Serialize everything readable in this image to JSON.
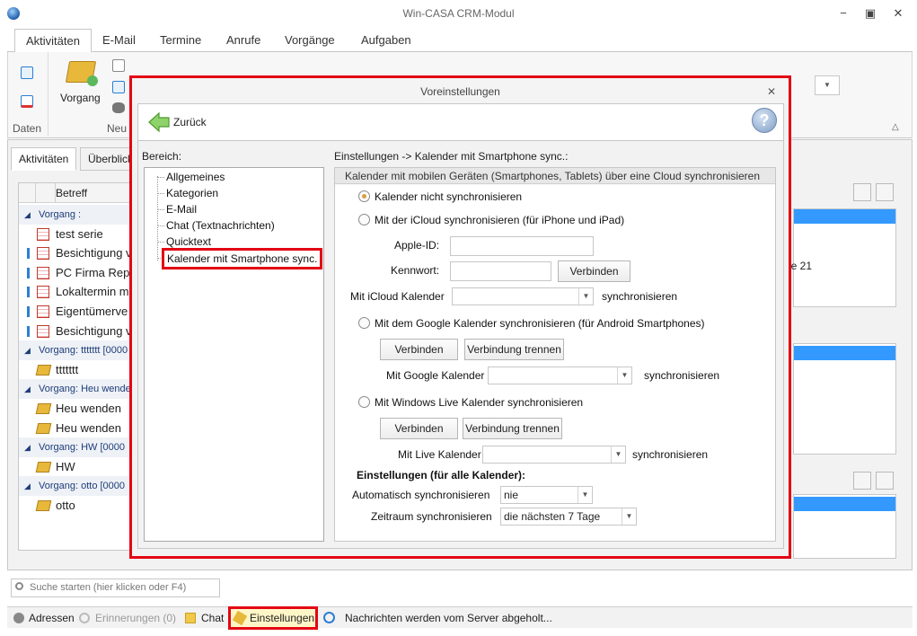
{
  "window": {
    "title": "Win-CASA CRM-Modul",
    "minimize": "−",
    "restore": "▣",
    "close": "✕"
  },
  "ribbon_tabs": [
    "Aktivitäten",
    "E-Mail",
    "Termine",
    "Anrufe",
    "Vorgänge",
    "Aufgaben"
  ],
  "ribbon": {
    "group_daten": "Daten",
    "vorgang_label": "Vorgang",
    "group_neu": "Neu",
    "collapse": "△"
  },
  "subtabs": [
    "Aktivitäten",
    "Überblick"
  ],
  "list": {
    "column_header": "Betreff",
    "rows": [
      {
        "type": "group",
        "text": "Vorgang :"
      },
      {
        "type": "item",
        "icon": "calendar-icon",
        "text": "test serie",
        "marked": false
      },
      {
        "type": "item",
        "icon": "calendar-icon",
        "text": "Besichtigung v",
        "marked": true
      },
      {
        "type": "item",
        "icon": "calendar-icon",
        "text": "PC Firma Rep",
        "marked": true
      },
      {
        "type": "item",
        "icon": "calendar-icon",
        "text": "Lokaltermin m",
        "marked": true
      },
      {
        "type": "item",
        "icon": "calendar-icon",
        "text": "Eigentümerve",
        "marked": true
      },
      {
        "type": "item",
        "icon": "calendar-icon",
        "text": "Besichtigung v",
        "marked": true
      },
      {
        "type": "group",
        "text": "Vorgang: ttttttt [0000"
      },
      {
        "type": "item",
        "icon": "vorgang-icon",
        "text": "ttttttt",
        "marked": false
      },
      {
        "type": "group",
        "text": "Vorgang: Heu wende"
      },
      {
        "type": "item",
        "icon": "vorgang-icon",
        "text": "Heu wenden",
        "marked": false
      },
      {
        "type": "item",
        "icon": "vorgang-icon",
        "text": "Heu wenden",
        "marked": false
      },
      {
        "type": "group",
        "text": "Vorgang: HW [0000"
      },
      {
        "type": "item",
        "icon": "vorgang-icon",
        "text": "HW",
        "marked": false
      },
      {
        "type": "group",
        "text": "Vorgang: otto [0000"
      },
      {
        "type": "item",
        "icon": "vorgang-icon",
        "text": "otto",
        "marked": false
      }
    ]
  },
  "right_panel": {
    "text": "ee 21"
  },
  "search": {
    "placeholder": "Suche starten (hier klicken oder F4)"
  },
  "statusbar": {
    "adressen": "Adressen",
    "erinnerungen": "Erinnerungen (0)",
    "chat": "Chat",
    "einstellungen": "Einstellungen",
    "message": "Nachrichten werden vom Server abgeholt..."
  },
  "dialog": {
    "title": "Voreinstellungen",
    "close": "✕",
    "back_label": "Zurück",
    "help": "?",
    "bereich_label": "Bereich:",
    "tree_items": [
      "Allgemeines",
      "Kategorien",
      "E-Mail",
      "Chat (Textnachrichten)",
      "Quicktext",
      "Kalender mit Smartphone sync."
    ],
    "breadcrumb": "Einstellungen -> Kalender mit Smartphone sync.:",
    "section_header": "Kalender mit mobilen Geräten (Smartphones, Tablets) über eine Cloud synchronisieren",
    "options": {
      "no_sync": "Kalender nicht synchronisieren",
      "icloud": "Mit der iCloud synchronisieren (für iPhone und iPad)",
      "google": "Mit dem Google Kalender synchronisieren (für Android Smartphones)",
      "live": "Mit Windows Live Kalender synchronisieren"
    },
    "icloud": {
      "apple_id_label": "Apple-ID:",
      "apple_id_value": "",
      "password_label": "Kennwort:",
      "password_value": "",
      "connect": "Verbinden",
      "calendar_label": "Mit iCloud Kalender",
      "calendar_value": "",
      "sync_suffix": "synchronisieren"
    },
    "google": {
      "connect": "Verbinden",
      "disconnect": "Verbindung trennen",
      "calendar_label": "Mit Google Kalender",
      "calendar_value": "",
      "sync_suffix": "synchronisieren"
    },
    "live": {
      "connect": "Verbinden",
      "disconnect": "Verbindung trennen",
      "calendar_label": "Mit Live Kalender",
      "calendar_value": "",
      "sync_suffix": "synchronisieren"
    },
    "all_settings": {
      "heading": "Einstellungen (für alle Kalender):",
      "auto_label": "Automatisch synchronisieren",
      "auto_value": "nie",
      "range_label": "Zeitraum synchronisieren",
      "range_value": "die nächsten 7 Tage"
    }
  },
  "colors": {
    "highlight": "#e30613",
    "selection_blue": "#3399ff",
    "group_text": "#1e3d7a"
  }
}
